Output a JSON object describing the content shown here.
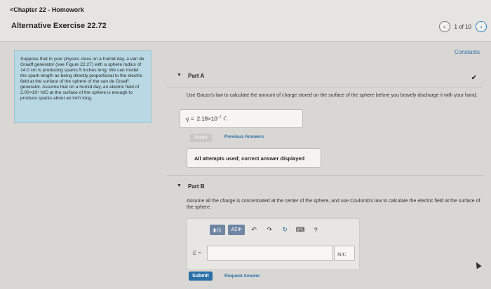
{
  "header": {
    "back_label": "<Chapter 22 - Homework",
    "title": "Alternative Exercise 22.72",
    "page_count": "1 of 10",
    "prev_icon": "chevron-left-icon",
    "next_icon": "chevron-right-icon"
  },
  "constants_link": "Constants",
  "problem_text": "Suppose that in your physics class on a humid day, a van de Graaff generator (see Figure 22.27) with a sphere radius of 14.0 cm is producing sparks 5 inches long. We can model the spark length as being directly proportional to the electric field at the surface of the sphere of the van de Graaff generator. Assume that on a humid day, an electric field of 2.00×10⁴ N/C at the surface of the sphere is enough to produce sparks about an inch long.",
  "part_a": {
    "title": "Part A",
    "prompt": "Use Gauss's law to calculate the amount of charge stored on the surface of the sphere before you bravely discharge it with your hand.",
    "answer_var": "q",
    "answer_eq": "=",
    "answer_value": "2.18×10",
    "answer_exp": "−7",
    "answer_unit": "C",
    "submit_label": "Submit",
    "previous_answers_label": "Previous Answers",
    "attempts_message": "All attempts used; correct answer displayed"
  },
  "part_b": {
    "title": "Part B",
    "prompt": "Assume all the charge is concentrated at the center of the sphere, and use Coulomb's law to calculate the electric field at the surface of the sphere.",
    "toolbar": {
      "templates_label": "▮√▯",
      "symbols_label": "ΑΣΦ",
      "undo_icon": "undo-icon",
      "redo_icon": "redo-icon",
      "reset_icon": "reset-icon",
      "keyboard_icon": "keyboard-icon",
      "help_label": "?"
    },
    "input_label": "E =",
    "unit": "N/C",
    "submit_label": "Submit",
    "request_answer_label": "Request Answer"
  },
  "colors": {
    "accent": "#2a6fa8",
    "problem_bg": "#b8d8e4",
    "toolbar_btn": "#6f86a4"
  }
}
